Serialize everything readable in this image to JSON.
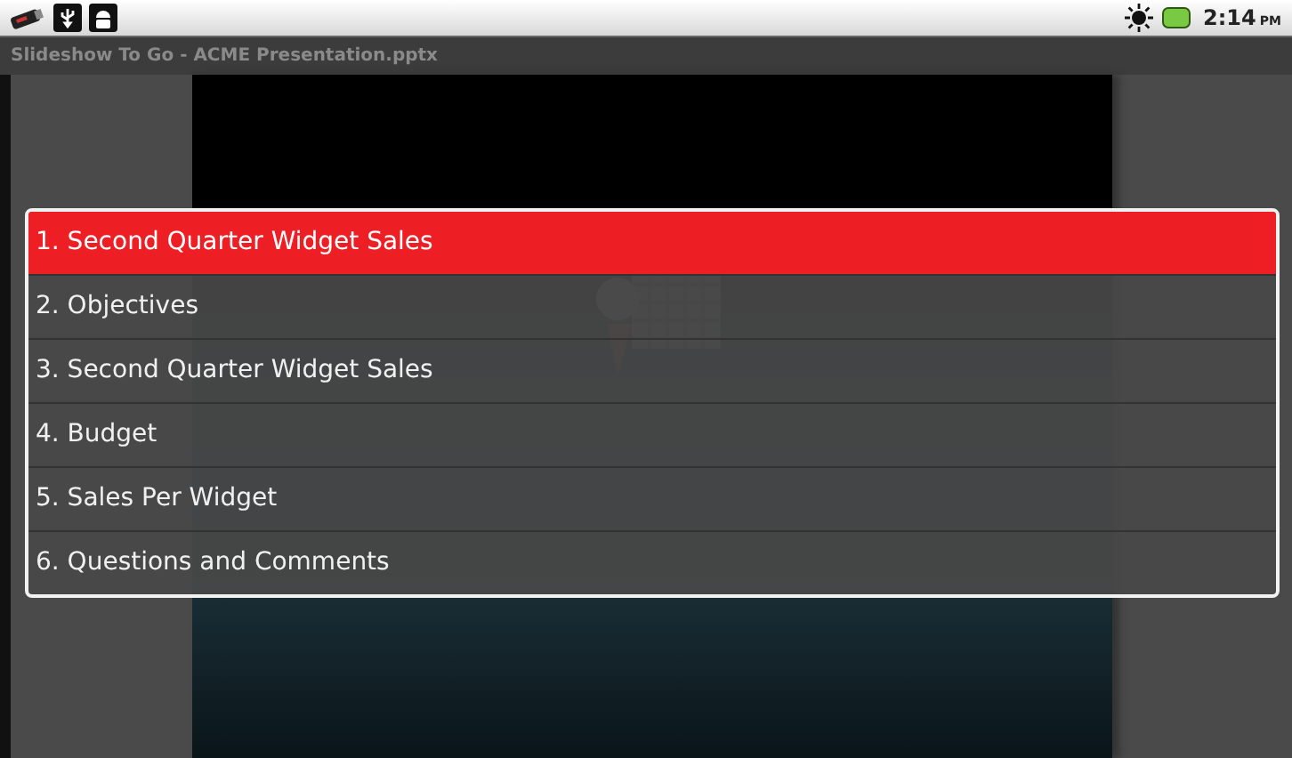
{
  "status_bar": {
    "time": "2:14",
    "meridiem": "PM"
  },
  "window": {
    "title": "Slideshow To Go - ACME Presentation.pptx"
  },
  "slide_list": [
    {
      "label": "1. Second Quarter Widget Sales",
      "selected": true
    },
    {
      "label": "2. Objectives",
      "selected": false
    },
    {
      "label": "3. Second Quarter Widget Sales",
      "selected": false
    },
    {
      "label": "4. Budget",
      "selected": false
    },
    {
      "label": "5. Sales Per Widget",
      "selected": false
    },
    {
      "label": "6. Questions and Comments",
      "selected": false
    }
  ]
}
